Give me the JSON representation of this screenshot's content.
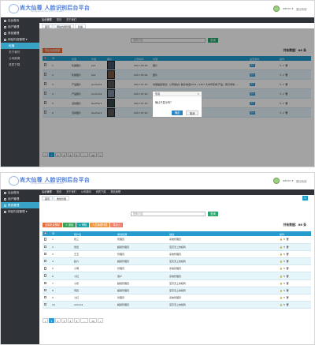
{
  "logo": {
    "title": "尚大仙尊 人脸识别后台平台",
    "subtitle": "Shangda Xianzun Admin System"
  },
  "user": {
    "name": "admin ▾",
    "logout": "退出系统"
  },
  "screen1": {
    "sidebar": [
      {
        "label": "后台首页"
      },
      {
        "label": "用户管理"
      },
      {
        "label": "角色管理"
      },
      {
        "label": "网站内容管理 ▾",
        "expanded": true
      },
      {
        "label": "轮播"
      },
      {
        "label": "关于我们"
      },
      {
        "label": "公司新闻"
      },
      {
        "label": "资质下载"
      }
    ],
    "topnav": [
      "后台管理",
      "首页",
      "关于我们"
    ],
    "tabs": [
      "首页",
      "网站内容管理",
      "轮播"
    ],
    "search": {
      "placeholder": "搜索内容",
      "button": "查询"
    },
    "toolbar": [
      "导出全部数据"
    ],
    "total": "共有数据：66 条",
    "columns": [
      "",
      "ID",
      "标题",
      "作者",
      "图片",
      "上传时间",
      "内容",
      "是否发布",
      "操作"
    ],
    "rows": [
      [
        "1",
        "轮播图片",
        "pz1",
        "2017-03-16",
        "图片",
        "发布"
      ],
      [
        "2",
        "轮播图片",
        "pz2",
        "2017-05-02",
        "图片",
        "发布"
      ],
      [
        "3",
        "产品图片",
        "product1",
        "2017-07-10",
        "内容描述测试：",
        "发布"
      ],
      [
        "4",
        "产品图片",
        "product2",
        "2017-07-10",
        "",
        "发布"
      ],
      [
        "5",
        "活动图片",
        "teacher1",
        "2017-07-10",
        "图片",
        "发布"
      ],
      [
        "6",
        "活动图片",
        "teacher2",
        "2017-07-10",
        "图片",
        "发布"
      ]
    ],
    "pager": [
      "«",
      "1",
      "2",
      "3",
      "4",
      "5",
      "...",
      "10",
      "»"
    ],
    "modal": {
      "title": "信息",
      "close": "×",
      "message": "确认不显示吗？",
      "ok": "确定",
      "cancel": "取消",
      "ghost": "内容描述测试：公司地址1 联系电话0701 / 1207 大中华区域 产品，我们非常 ..."
    }
  },
  "screen2": {
    "sidebar": [
      {
        "label": "后台首页"
      },
      {
        "label": "用户管理"
      },
      {
        "label": "角色管理",
        "active": true
      },
      {
        "label": "网站内容管理 ▾"
      }
    ],
    "topnav": [
      "后台管理",
      "首页",
      "关于我们",
      "公司新闻",
      "资质下载",
      "角色管理"
    ],
    "tabs": [
      "首页",
      "角色管理"
    ],
    "search": {
      "placeholder": "搜索内容",
      "button": "查询"
    },
    "toolbar": [
      "全部批量删除",
      "+ 添加",
      "✔ 审核",
      "人员管理列表",
      "导出入"
    ],
    "total": "共有数据：66 条",
    "columns": [
      "",
      "ID",
      "用户名",
      "角色权限",
      "描述",
      "操作"
    ],
    "rows": [
      [
        "1",
        "张三",
        "管理员",
        "系统管理员"
      ],
      [
        "2",
        "张四",
        "超级管理员",
        "至高无上的权利"
      ],
      [
        "3",
        "王五",
        "管理员",
        "系统管理员"
      ],
      [
        "4",
        "赵六",
        "超级管理员",
        "至高无上的权利"
      ],
      [
        "5",
        "小明",
        "管理员",
        "系统管理员"
      ],
      [
        "6",
        "小红",
        "用户",
        "系统管理员"
      ],
      [
        "7",
        "小张",
        "超级管理员",
        "至高无上的权利"
      ],
      [
        "8",
        "周四",
        "超级管理员",
        "至高无上的权利"
      ],
      [
        "9",
        "小红",
        "管理员",
        "系统管理员"
      ],
      [
        "10",
        "Admin1",
        "超级管理员",
        "至高无上的权利"
      ]
    ],
    "pager": [
      "«",
      "1",
      "2",
      "3",
      "4",
      "5",
      "...",
      "10",
      "»"
    ]
  }
}
